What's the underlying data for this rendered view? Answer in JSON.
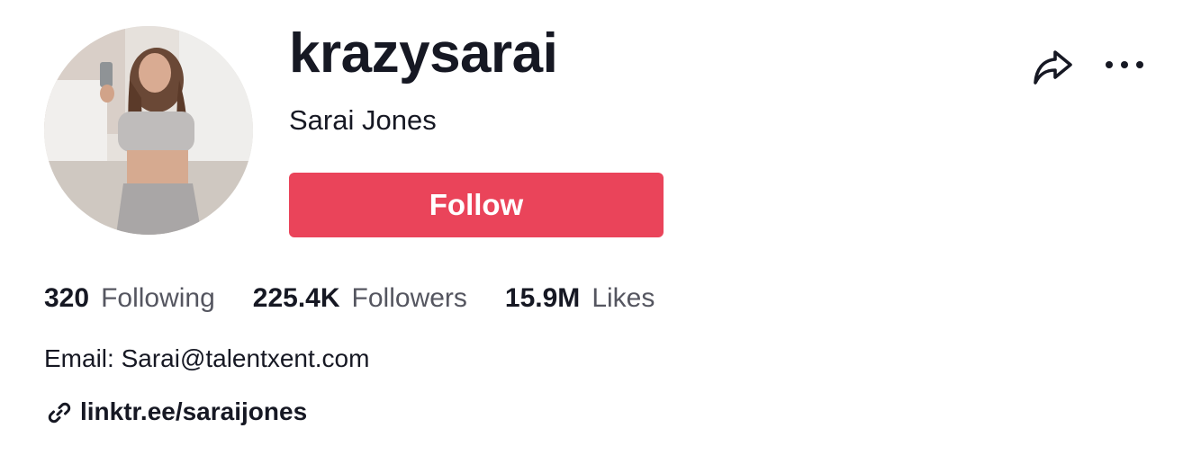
{
  "profile": {
    "username": "krazysarai",
    "nickname": "Sarai Jones",
    "avatar_icon": "user-avatar-photo"
  },
  "actions": {
    "follow_label": "Follow",
    "follow_color": "#ea445a",
    "share_icon": "share-arrow-icon",
    "more_icon": "more-dots-icon"
  },
  "stats": [
    {
      "value": "320",
      "label": "Following"
    },
    {
      "value": "225.4K",
      "label": "Followers"
    },
    {
      "value": "15.9M",
      "label": "Likes"
    }
  ],
  "bio": {
    "text": "Email: Sarai@talentxent.com"
  },
  "link": {
    "icon": "link-icon",
    "text": "linktr.ee/saraijones"
  }
}
